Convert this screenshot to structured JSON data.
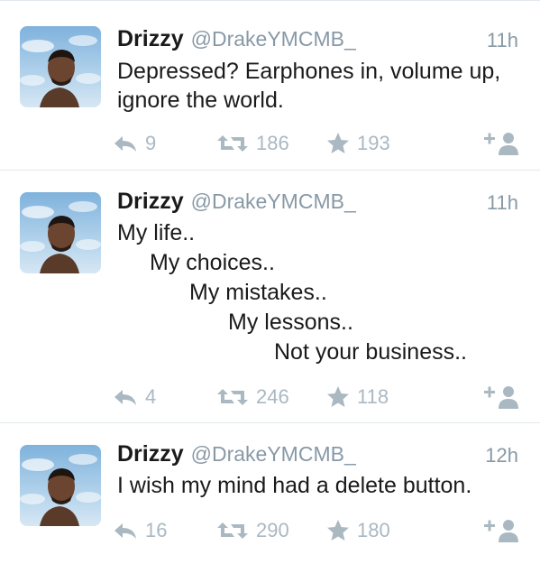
{
  "tweets": [
    {
      "name": "Drizzy",
      "handle": "@DrakeYMCMB_",
      "time": "11h",
      "lines": [
        "Depressed? Earphones in, volume up,",
        "ignore the world."
      ],
      "replies": "9",
      "retweets": "186",
      "favorites": "193"
    },
    {
      "name": "Drizzy",
      "handle": "@DrakeYMCMB_",
      "time": "11h",
      "lines": [
        "My life..",
        "My choices..",
        "My mistakes..",
        "My lessons..",
        "Not your business.."
      ],
      "replies": "4",
      "retweets": "246",
      "favorites": "118"
    },
    {
      "name": "Drizzy",
      "handle": "@DrakeYMCMB_",
      "time": "12h",
      "lines": [
        "I wish my mind had a delete button."
      ],
      "replies": "16",
      "retweets": "290",
      "favorites": "180"
    }
  ],
  "icons": {
    "reply": "reply-icon",
    "retweet": "retweet-icon",
    "favorite": "star-icon",
    "follow": "follow-icon"
  },
  "colors": {
    "text": "#1a1a1a",
    "muted": "#8899a6",
    "icon": "#aab8c2",
    "divider": "#e1e8ed"
  }
}
